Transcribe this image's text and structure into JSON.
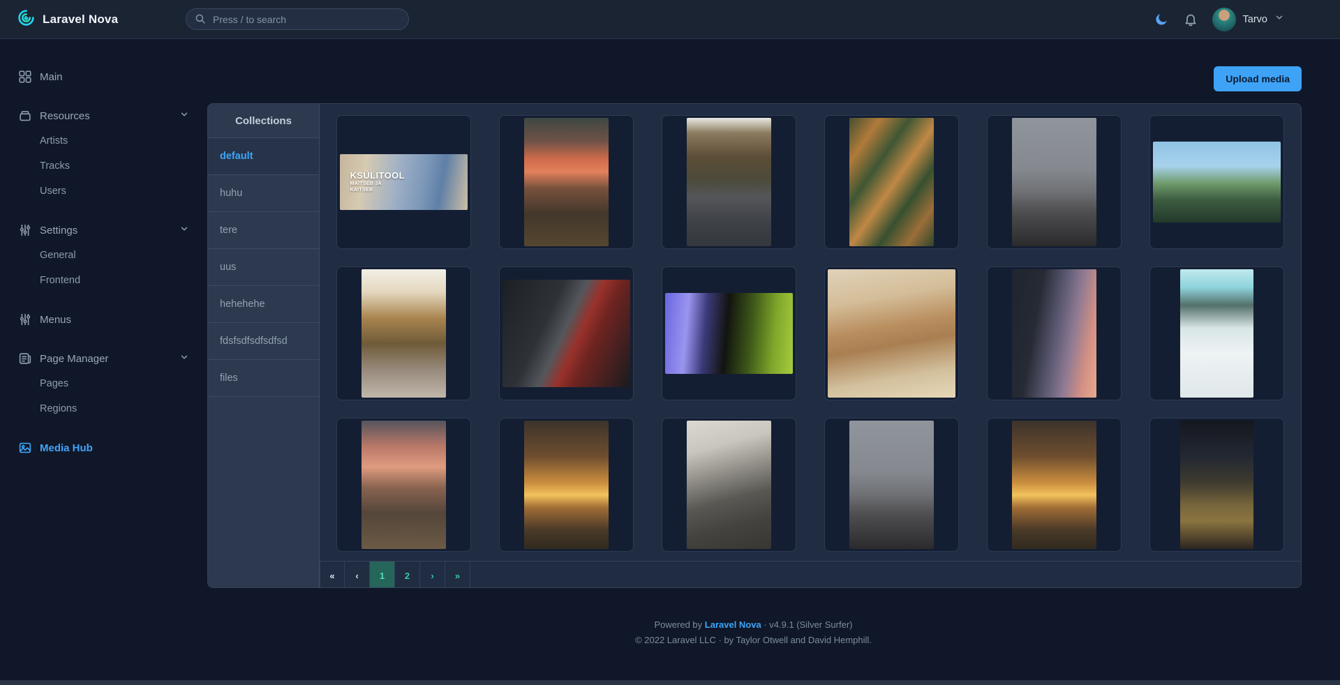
{
  "topbar": {
    "brand": "Laravel Nova",
    "search_placeholder": "Press / to search",
    "user_name": "Tarvo"
  },
  "sidebar": {
    "items": [
      {
        "label": "Main",
        "icon": "grid-icon"
      },
      {
        "label": "Resources",
        "icon": "archive-icon",
        "children": [
          "Artists",
          "Tracks",
          "Users"
        ]
      },
      {
        "label": "Settings",
        "icon": "sliders-icon",
        "children": [
          "General",
          "Frontend"
        ]
      },
      {
        "label": "Menus",
        "icon": "sliders-icon"
      },
      {
        "label": "Page Manager",
        "icon": "pages-icon",
        "children": [
          "Pages",
          "Regions"
        ]
      },
      {
        "label": "Media Hub",
        "icon": "image-icon",
        "active": true
      }
    ]
  },
  "main": {
    "upload_button": "Upload media",
    "collections": {
      "title": "Collections",
      "items": [
        {
          "label": "default",
          "active": true
        },
        {
          "label": "huhu"
        },
        {
          "label": "tere"
        },
        {
          "label": "uus"
        },
        {
          "label": "hehehehe"
        },
        {
          "label": "fdsfsdfsdfsdfsd"
        },
        {
          "label": "files"
        }
      ]
    },
    "media": {
      "items": [
        {
          "name": "child-banner",
          "kind": "banner",
          "overlay_title": "KSÜLITOOL",
          "overlay_lines": [
            "MAITSEB JA",
            "KAITSEB"
          ],
          "gradient": "linear-gradient(100deg,#c4b49b 0%,#d6cab2 20%,#9fb0c5 45%,#7b97b8 65%,#5f7fa6 78%,#cdbfa6 100%)"
        },
        {
          "name": "sunset-rocks",
          "kind": "portrait-wide",
          "gradient": "linear-gradient(180deg,#3d4742 0%,#6e5247 18%,#cf6a4a 32%,#e2815c 42%,#77503c 55%,#42382b 75%,#55462f 100%)"
        },
        {
          "name": "redwood-road",
          "kind": "portrait-wide",
          "gradient": "linear-gradient(180deg,#e8e8e2 0%,#8a7a5e 12%,#5d4e38 30%,#4c4a3a 48%,#55565a 62%,#3f4248 80%,#34373d 100%)"
        },
        {
          "name": "autumn-forest-aerial",
          "kind": "portrait-wide",
          "gradient": "linear-gradient(125deg,#44502f 0%,#b07a3a 18%,#3f5634 35%,#c08845 52%,#375030 68%,#9a6e38 84%,#2f462c 100%)"
        },
        {
          "name": "telescope-paris",
          "kind": "portrait-wide",
          "gradient": "linear-gradient(180deg,#90959c 0%,#85898f 40%,#6e7074 58%,#4d4c4e 74%,#2b2a2c 100%)"
        },
        {
          "name": "supertree-grove",
          "kind": "landscape",
          "gradient": "linear-gradient(180deg,#8fc3e4 0%,#a8d2ec 30%,#6e9a6a 52%,#3c5c40 72%,#23392b 100%)"
        },
        {
          "name": "autumn-path",
          "kind": "portrait-wide",
          "gradient": "linear-gradient(180deg,#f2efe6 0%,#e3d6bd 18%,#a9854f 38%,#6f5b39 58%,#97897b 78%,#c0b7aa 100%)"
        },
        {
          "name": "cinema-camera",
          "kind": "landscape-tall",
          "gradient": "linear-gradient(115deg,#1c1f24 0%,#2e3238 35%,#53575c 48%,#99312b 58%,#6e2420 68%,#191b1f 100%)"
        },
        {
          "name": "jellyfish",
          "kind": "landscape",
          "gradient": "linear-gradient(95deg,#6b66e0 0%,#9a95ef 18%,#3b3a7a 32%,#121410 48%,#3d5718 66%,#7fa62a 84%,#a6cc3f 100%)"
        },
        {
          "name": "hooded-person",
          "kind": "full",
          "gradient": "linear-gradient(170deg,#e0d2ba 0%,#d4bd98 25%,#b98f60 45%,#a97f52 58%,#d2bf9c 80%,#e6d8b8 100%)"
        },
        {
          "name": "lantern-sunset",
          "kind": "portrait-wide",
          "gradient": "linear-gradient(100deg,#20242e 0%,#262a34 30%,#5d5a74 52%,#907a92 68%,#d49084 85%,#e8a98e 100%)"
        },
        {
          "name": "snowy-road",
          "kind": "portrait",
          "gradient": "linear-gradient(180deg,#bfe9ed 0%,#8fd4dd 14%,#53706a 28%,#d9e6e6 46%,#eef3f4 66%,#dfe7e9 100%)"
        },
        {
          "name": "sunset-rocks-2",
          "kind": "portrait-wide",
          "gradient": "linear-gradient(180deg,#55545c 0%,#b97868 20%,#e09b80 36%,#8a6450 52%,#54463a 72%,#6b5a44 100%)"
        },
        {
          "name": "drone-sunset",
          "kind": "portrait-wide",
          "gradient": "linear-gradient(180deg,#3c332c 0%,#6e4e2e 28%,#c98c3e 48%,#f2c35c 58%,#a06c35 68%,#4a3a28 85%,#322a20 100%)"
        },
        {
          "name": "street-crossing",
          "kind": "portrait-wide",
          "gradient": "linear-gradient(165deg,#dcd9d0 0%,#c9c6bd 22%,#8e8c85 42%,#5a5853 60%,#45433f 78%,#383632 100%)"
        },
        {
          "name": "telescope-paris-2",
          "kind": "portrait-wide",
          "gradient": "linear-gradient(180deg,#90959c 0%,#85898f 40%,#6e7074 58%,#4d4c4e 74%,#2b2a2c 100%)"
        },
        {
          "name": "drone-sunset-2",
          "kind": "portrait-wide",
          "gradient": "linear-gradient(180deg,#3c332c 0%,#6e4e2e 28%,#c98c3e 48%,#f2c35c 58%,#a06c35 68%,#4a3a28 85%,#322a20 100%)"
        },
        {
          "name": "night-traffic",
          "kind": "portrait",
          "gradient": "linear-gradient(180deg,#14171e 0%,#232833 28%,#3e3a2e 48%,#77653c 66%,#8a7440 78%,#2c2620 100%)"
        }
      ]
    },
    "pagination": {
      "buttons": [
        {
          "label": "«",
          "style": "light",
          "name": "pagination-first"
        },
        {
          "label": "‹",
          "style": "light",
          "name": "pagination-previous"
        },
        {
          "label": "1",
          "style": "active",
          "name": "pagination-page-1"
        },
        {
          "label": "2",
          "style": "teal",
          "name": "pagination-page-2"
        },
        {
          "label": "›",
          "style": "teal",
          "name": "pagination-next"
        },
        {
          "label": "»",
          "style": "teal",
          "name": "pagination-last"
        }
      ]
    }
  },
  "footer": {
    "powered_prefix": "Powered by ",
    "brand": "Laravel Nova",
    "version_suffix": " · v4.9.1 (Silver Surfer)",
    "copyright": "© 2022 Laravel LLC · by Taylor Otwell and David Hemphill."
  },
  "colors": {
    "accent_blue": "#3ea3f7",
    "accent_teal": "#39c9a6",
    "active_page_bg": "#25655a",
    "page_bg": "#0f1728",
    "panel_bg": "#202c42",
    "collections_bg": "#2c394e"
  }
}
